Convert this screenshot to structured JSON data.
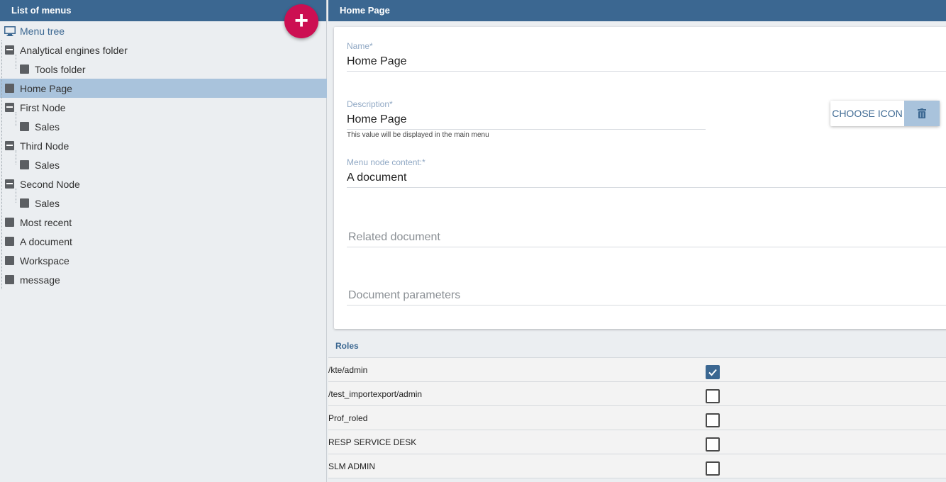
{
  "left_panel": {
    "title": "List of menus",
    "add_button": "+",
    "tree": [
      {
        "label": "Menu tree",
        "level": 0,
        "icon": "monitor-icon"
      },
      {
        "label": "Analytical engines folder",
        "level": 0,
        "icon": "collapse-icon"
      },
      {
        "label": "Tools folder",
        "level": 1,
        "icon": "leaf-icon"
      },
      {
        "label": "Home Page",
        "level": 0,
        "icon": "leaf-icon",
        "selected": true
      },
      {
        "label": "First Node",
        "level": 0,
        "icon": "collapse-icon"
      },
      {
        "label": "Sales",
        "level": 1,
        "icon": "leaf-icon"
      },
      {
        "label": "Third Node",
        "level": 0,
        "icon": "collapse-icon"
      },
      {
        "label": "Sales",
        "level": 1,
        "icon": "leaf-icon"
      },
      {
        "label": "Second Node",
        "level": 0,
        "icon": "collapse-icon"
      },
      {
        "label": "Sales",
        "level": 1,
        "icon": "leaf-icon"
      },
      {
        "label": "Most recent",
        "level": 0,
        "icon": "leaf-icon"
      },
      {
        "label": "A document",
        "level": 0,
        "icon": "leaf-icon"
      },
      {
        "label": "Workspace",
        "level": 0,
        "icon": "leaf-icon"
      },
      {
        "label": "message",
        "level": 0,
        "icon": "leaf-icon"
      }
    ]
  },
  "right_panel": {
    "title": "Home Page",
    "form": {
      "name_label": "Name",
      "name_value": "Home Page",
      "description_label": "Description",
      "description_value": "Home Page",
      "description_hint": "This value will be displayed in the main menu",
      "content_label": "Menu node content:",
      "content_value": "A document",
      "related_document_placeholder": "Related document",
      "document_parameters_placeholder": "Document parameters",
      "required_marker": "*"
    },
    "choose_icon_label": "CHOOSE ICON",
    "delete_icon": "trash-icon",
    "roles_title": "Roles",
    "roles": [
      {
        "name": "/kte/admin",
        "checked": true
      },
      {
        "name": "/test_importexport/admin",
        "checked": false
      },
      {
        "name": "Prof_roled",
        "checked": false
      },
      {
        "name": "RESP SERVICE DESK",
        "checked": false
      },
      {
        "name": "SLM ADMIN",
        "checked": false
      }
    ]
  },
  "colors": {
    "header": "#3b6791",
    "accent_fab": "#cc0f52",
    "selected_row": "#a9c3dc"
  }
}
